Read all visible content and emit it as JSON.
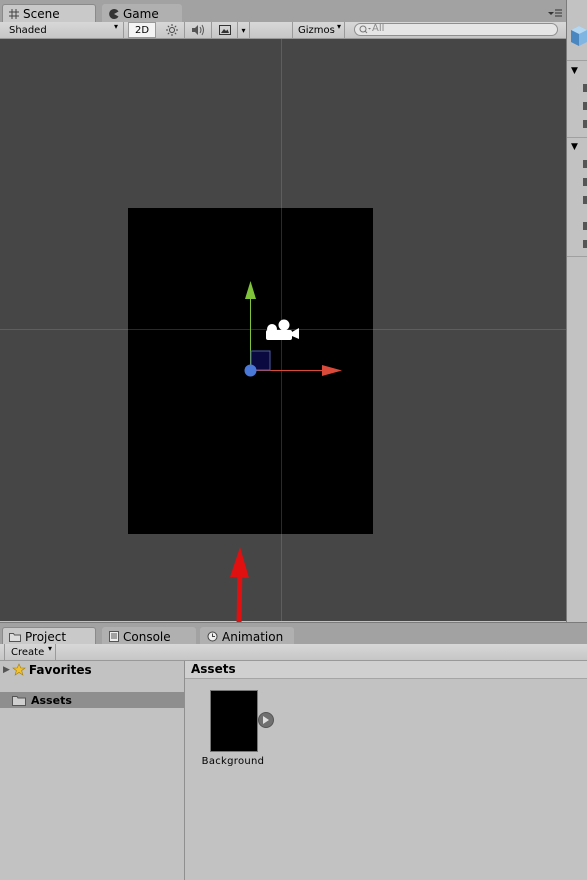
{
  "scene_tabs": [
    {
      "label": "Scene",
      "icon": "hash-icon",
      "active": true
    },
    {
      "label": "Game",
      "icon": "pacman-icon",
      "active": false
    }
  ],
  "scene_toolbar": {
    "shading_mode": "Shaded",
    "mode_2d": "2D",
    "gizmos_label": "Gizmos",
    "search_placeholder": "All"
  },
  "bottom_tabs": [
    {
      "label": "Project",
      "icon": "folder-icon",
      "active": true
    },
    {
      "label": "Console",
      "icon": "console-icon",
      "active": false
    },
    {
      "label": "Animation",
      "icon": "clock-icon",
      "active": false
    }
  ],
  "project": {
    "create_label": "Create",
    "favorites_label": "Favorites",
    "assets_label": "Assets",
    "breadcrumb": "Assets",
    "asset_items": [
      {
        "label": "Background",
        "icon": "sprite-thumbnail"
      }
    ]
  },
  "colors": {
    "viewport_bg": "#464646",
    "camera_bounds": "#000000",
    "x_axis": "#d94a3a",
    "y_axis": "#7ec33a",
    "pivot": "#4a78d8",
    "annotation_arrow": "#e01010"
  }
}
